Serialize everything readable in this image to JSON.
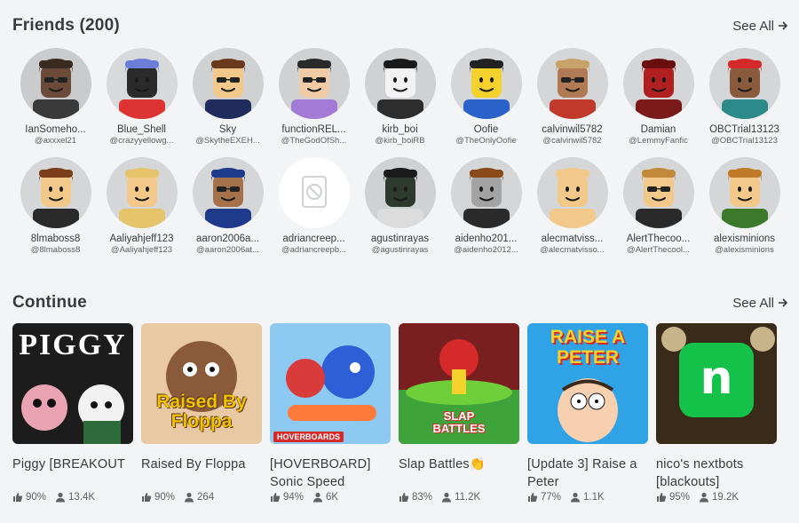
{
  "friends": {
    "title": "Friends (200)",
    "see_all": "See All",
    "items": [
      {
        "name": "IanSomeho...",
        "username": "@axxxel21",
        "bg": "#c9cbcd",
        "skin": "#6b4a3a",
        "hair": "#3a2a20",
        "shirt": "#3a3a3a",
        "glasses": true
      },
      {
        "name": "Blue_Shell",
        "username": "@crazyyellowg...",
        "bg": "#d7d9db",
        "skin": "#2b2b2b",
        "hair": "#6b7fd9",
        "shirt": "#d33",
        "glasses": false
      },
      {
        "name": "Sky",
        "username": "@SkytheEXEH...",
        "bg": "#cfd1d3",
        "skin": "#f3c98b",
        "hair": "#6b3a1e",
        "shirt": "#1f2c5c",
        "glasses": true
      },
      {
        "name": "functionREL...",
        "username": "@TheGodOfSh...",
        "bg": "#cfd1d3",
        "skin": "#f1cba6",
        "hair": "#2a2a2a",
        "shirt": "#a37bd6",
        "glasses": true
      },
      {
        "name": "kirb_boi",
        "username": "@kirb_boiRB",
        "bg": "#cfd1d3",
        "skin": "#f2f2f2",
        "hair": "#1a1a1a",
        "shirt": "#2d2d2d",
        "glasses": false
      },
      {
        "name": "Oofie",
        "username": "@TheOnlyOofie",
        "bg": "#d4d6d8",
        "skin": "#f5d22b",
        "hair": "#222222",
        "shirt": "#2b62c9",
        "glasses": false
      },
      {
        "name": "calvinwil5782",
        "username": "@calvinwil5782",
        "bg": "#d4d6d8",
        "skin": "#b07a54",
        "hair": "#c7a36b",
        "shirt": "#c0392b",
        "glasses": true
      },
      {
        "name": "Damian",
        "username": "@LemmyFanfic",
        "bg": "#d4d6d8",
        "skin": "#b02020",
        "hair": "#6a0d0d",
        "shirt": "#7a1a1a",
        "glasses": false
      },
      {
        "name": "OBCTrial13123",
        "username": "@OBCTrial13123",
        "bg": "#d4d6d8",
        "skin": "#8a5a3c",
        "hair": "#d62a2a",
        "shirt": "#2d8a8a",
        "glasses": false
      },
      {
        "name": "8lmaboss8",
        "username": "@8lmaboss8",
        "bg": "#d4d6d8",
        "skin": "#f3c98b",
        "hair": "#7a3e1a",
        "shirt": "#2a2a2a",
        "glasses": false
      },
      {
        "name": "Aaliyahjeff123",
        "username": "@Aaliyahjeff123",
        "bg": "#d4d6d8",
        "skin": "#f3c98b",
        "hair": "#e6c46b",
        "shirt": "#e6c46b",
        "glasses": false
      },
      {
        "name": "aaron2006a...",
        "username": "@aaron2006at...",
        "bg": "#d4d6d8",
        "skin": "#a5714b",
        "hair": "#1f3a8a",
        "shirt": "#1f3a8a",
        "glasses": true
      },
      {
        "name": "adriancreep...",
        "username": "@adriancreepb...",
        "bg": "#ffffff",
        "blank": true
      },
      {
        "name": "agustinrayas",
        "username": "@agustinrayas",
        "bg": "#cfd1d3",
        "skin": "#2d3a2d",
        "hair": "#1b1b1b",
        "shirt": "#dcdcdc",
        "glasses": false
      },
      {
        "name": "aidenho201...",
        "username": "@aidenho2012...",
        "bg": "#d4d6d8",
        "skin": "#a3a3a3",
        "hair": "#8a4a1a",
        "shirt": "#2a2a2a",
        "glasses": false
      },
      {
        "name": "alecmatviss...",
        "username": "@alecmatvisso...",
        "bg": "#d4d6d8",
        "skin": "#f3c98b",
        "hair": "#f3c98b",
        "shirt": "#f3c98b",
        "glasses": false
      },
      {
        "name": "AlertThecoo...",
        "username": "@AlertThecool...",
        "bg": "#d4d6d8",
        "skin": "#f3c98b",
        "hair": "#c08a3a",
        "shirt": "#2a2a2a",
        "glasses": true
      },
      {
        "name": "alexisminions",
        "username": "@alexisminions",
        "bg": "#d4d6d8",
        "skin": "#f3c98b",
        "hair": "#c07a2a",
        "shirt": "#3a7a2a",
        "glasses": false
      }
    ]
  },
  "continue": {
    "title": "Continue",
    "see_all": "See All",
    "games": [
      {
        "title": "Piggy [BREAKOUT",
        "like": "90%",
        "players": "13.4K",
        "thumb_text": "PIGGY",
        "thumb_bg": "#1c1c1c",
        "thumb_fg": "#ffffff",
        "accent": "#e9a3b3"
      },
      {
        "title": "Raised By Floppa",
        "like": "90%",
        "players": "264",
        "thumb_text": "Raised By Floppa",
        "thumb_bg": "#e9c9a3",
        "thumb_fg": "#f2c200",
        "accent": "#8a5a3a"
      },
      {
        "title": "[HOVERBOARD] Sonic Speed",
        "like": "94%",
        "players": "6K",
        "thumb_text": "HOVERBOARDS",
        "thumb_bg": "#8ec9f2",
        "thumb_fg": "#ffffff",
        "accent": "#2e5fd6"
      },
      {
        "title": "Slap Battles👏",
        "like": "83%",
        "players": "11.2K",
        "thumb_text": "SLAP BATTLES",
        "thumb_bg": "#7a1f1f",
        "thumb_fg": "#ffffff",
        "accent": "#6fcf3a"
      },
      {
        "title": "[Update 3] Raise a Peter",
        "like": "77%",
        "players": "1.1K",
        "thumb_text": "RAISE A PETER",
        "thumb_bg": "#2fa3e6",
        "thumb_fg": "#f5d22b",
        "accent": "#ffffff"
      },
      {
        "title": "nico's nextbots [blackouts]",
        "like": "95%",
        "players": "19.2K",
        "thumb_text": "n",
        "thumb_bg": "#0f1f12",
        "thumb_fg": "#ffffff",
        "accent": "#14c24a"
      }
    ]
  }
}
